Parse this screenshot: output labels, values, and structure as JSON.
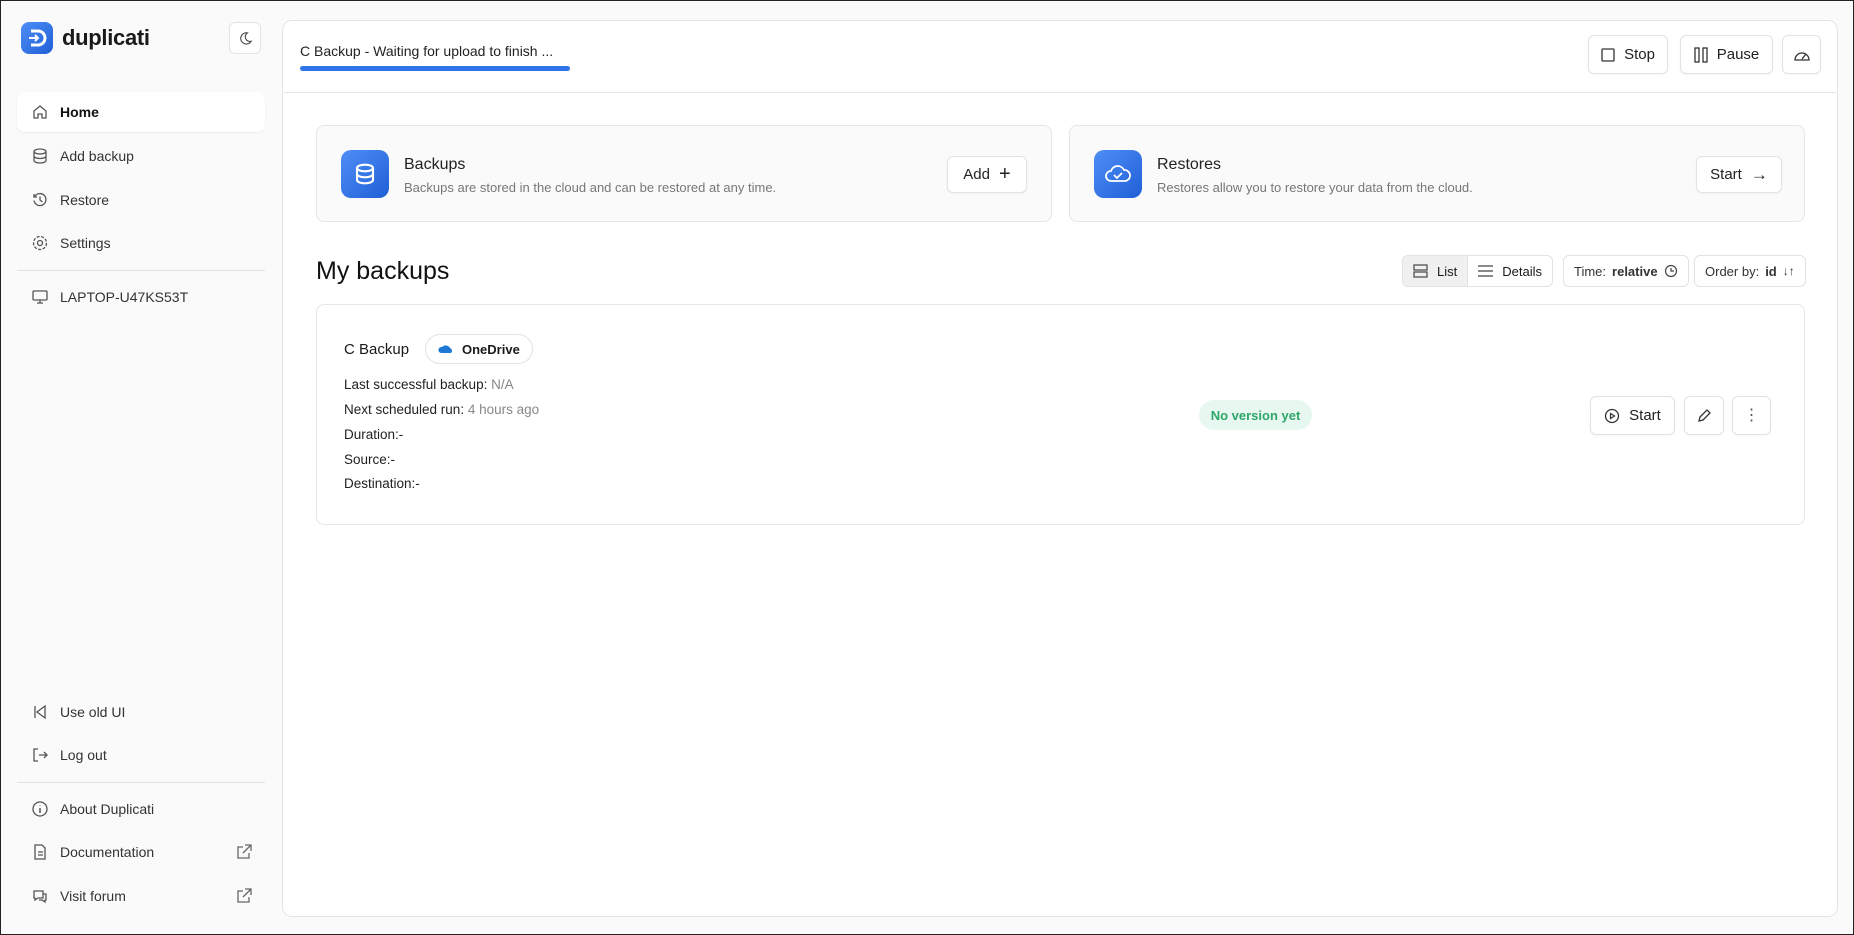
{
  "app": {
    "name": "duplicati"
  },
  "sidebar": {
    "items": [
      {
        "label": "Home"
      },
      {
        "label": "Add backup"
      },
      {
        "label": "Restore"
      },
      {
        "label": "Settings"
      }
    ],
    "machine": "LAPTOP-U47KS53T",
    "bottom": [
      {
        "label": "Use old UI"
      },
      {
        "label": "Log out"
      },
      {
        "label": "About Duplicati"
      },
      {
        "label": "Documentation"
      },
      {
        "label": "Visit forum"
      }
    ]
  },
  "header": {
    "status": "C Backup - Waiting for upload to finish ...",
    "progress_percent": 100,
    "stop": "Stop",
    "pause": "Pause"
  },
  "cards": {
    "backups": {
      "title": "Backups",
      "subtitle": "Backups are stored in the cloud and can be restored at any time.",
      "button": "Add"
    },
    "restores": {
      "title": "Restores",
      "subtitle": "Restores allow you to restore your data from the cloud.",
      "button": "Start"
    }
  },
  "list": {
    "title": "My backups",
    "view_list": "List",
    "view_details": "Details",
    "time_label": "Time:",
    "time_value": "relative",
    "order_label": "Order by:",
    "order_value": "id"
  },
  "backup": {
    "name": "C Backup",
    "destination_badge": "OneDrive",
    "last_label": "Last successful backup:",
    "last_value": "N/A",
    "next_label": "Next scheduled run:",
    "next_value": "4 hours ago",
    "duration": "Duration:-",
    "source": "Source:-",
    "destination": "Destination:-",
    "status": "No version yet",
    "start": "Start"
  },
  "colors": {
    "accent": "#2f74e6",
    "badge_bg": "#e6f8ef",
    "badge_text": "#2fa66a"
  }
}
